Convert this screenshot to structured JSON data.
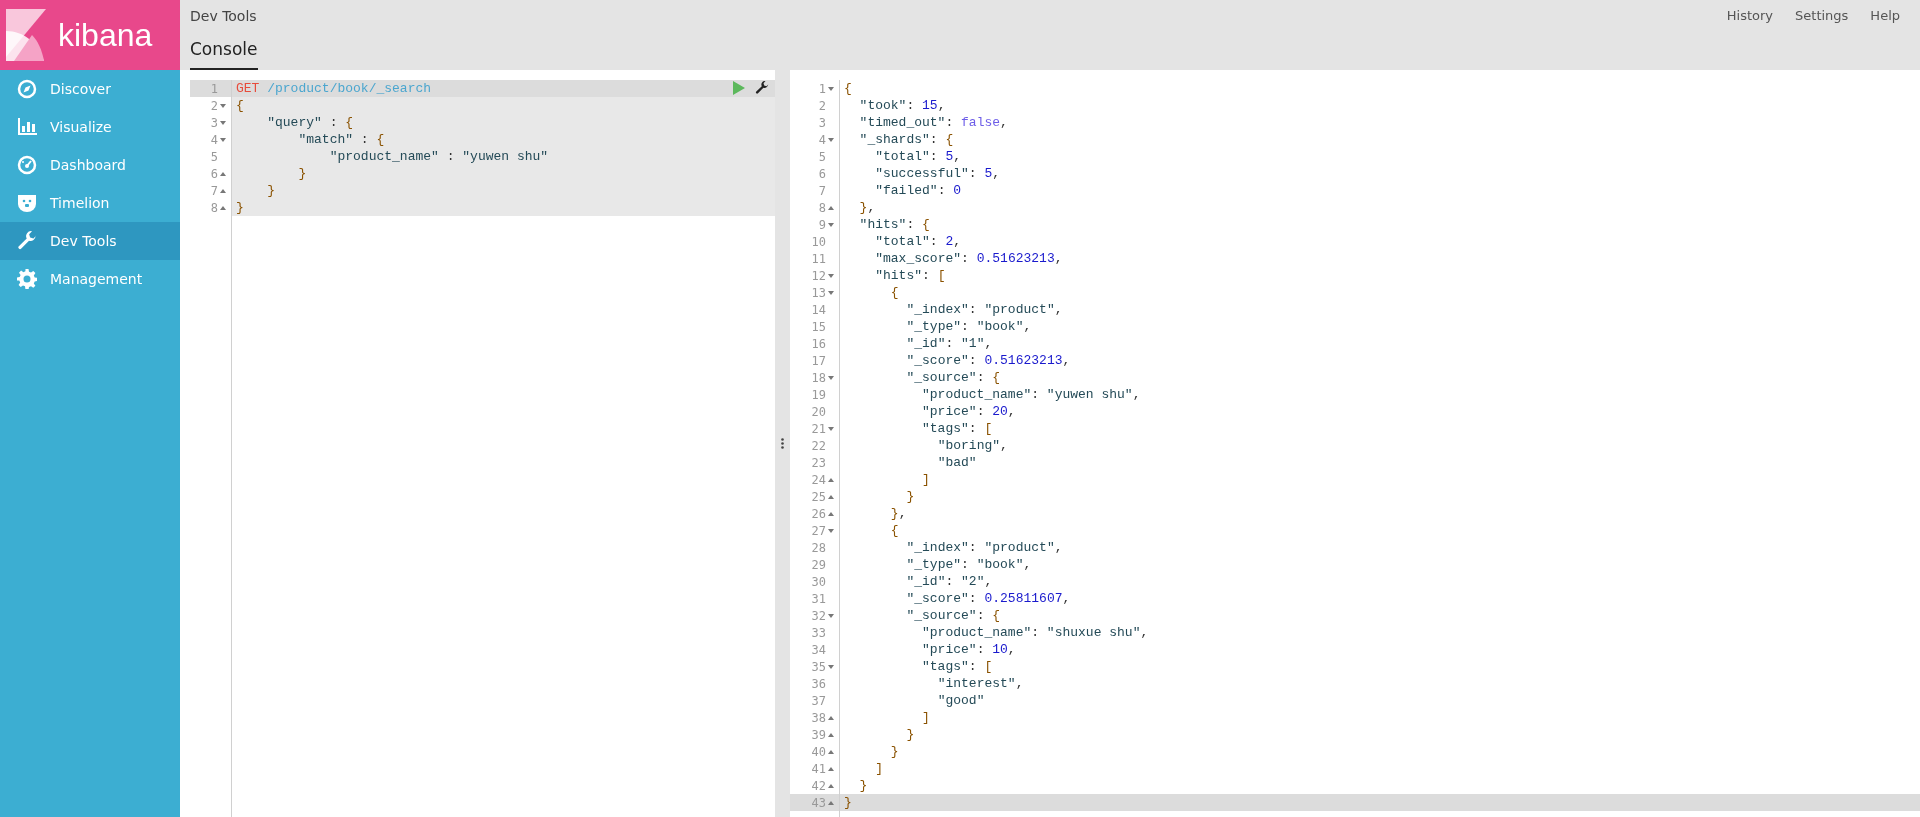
{
  "app": {
    "name": "kibana"
  },
  "nav": [
    {
      "label": "Discover",
      "selected": false
    },
    {
      "label": "Visualize",
      "selected": false
    },
    {
      "label": "Dashboard",
      "selected": false
    },
    {
      "label": "Timelion",
      "selected": false
    },
    {
      "label": "Dev Tools",
      "selected": true
    },
    {
      "label": "Management",
      "selected": false
    }
  ],
  "header": {
    "breadcrumb": "Dev Tools",
    "links": [
      "History",
      "Settings",
      "Help"
    ],
    "tabs": [
      {
        "label": "Console",
        "selected": true
      }
    ]
  },
  "request_editor": {
    "lines": [
      {
        "number": "1",
        "kind": "plain",
        "highlighted": true,
        "active": true,
        "text": "GET /product/book/_search"
      },
      {
        "number": "2",
        "kind": "open",
        "highlighted": true,
        "active": false,
        "text": "{"
      },
      {
        "number": "3",
        "kind": "open",
        "highlighted": true,
        "active": false,
        "text": "    \"query\" : {"
      },
      {
        "number": "4",
        "kind": "open",
        "highlighted": true,
        "active": false,
        "text": "        \"match\" : {"
      },
      {
        "number": "5",
        "kind": "plain",
        "highlighted": true,
        "active": false,
        "text": "            \"product_name\" : \"yuwen shu\""
      },
      {
        "number": "6",
        "kind": "close",
        "highlighted": true,
        "active": false,
        "text": "        }"
      },
      {
        "number": "7",
        "kind": "close",
        "highlighted": true,
        "active": false,
        "text": "    }"
      },
      {
        "number": "8",
        "kind": "close",
        "highlighted": true,
        "active": false,
        "text": "}"
      }
    ]
  },
  "response_editor": {
    "lines": [
      {
        "number": "1",
        "kind": "open",
        "active": false,
        "text": "{"
      },
      {
        "number": "2",
        "kind": "plain",
        "active": false,
        "text": "  \"took\": 15,"
      },
      {
        "number": "3",
        "kind": "plain",
        "active": false,
        "text": "  \"timed_out\": false,"
      },
      {
        "number": "4",
        "kind": "open",
        "active": false,
        "text": "  \"_shards\": {"
      },
      {
        "number": "5",
        "kind": "plain",
        "active": false,
        "text": "    \"total\": 5,"
      },
      {
        "number": "6",
        "kind": "plain",
        "active": false,
        "text": "    \"successful\": 5,"
      },
      {
        "number": "7",
        "kind": "plain",
        "active": false,
        "text": "    \"failed\": 0"
      },
      {
        "number": "8",
        "kind": "close",
        "active": false,
        "text": "  },"
      },
      {
        "number": "9",
        "kind": "open",
        "active": false,
        "text": "  \"hits\": {"
      },
      {
        "number": "10",
        "kind": "plain",
        "active": false,
        "text": "    \"total\": 2,"
      },
      {
        "number": "11",
        "kind": "plain",
        "active": false,
        "text": "    \"max_score\": 0.51623213,"
      },
      {
        "number": "12",
        "kind": "open",
        "active": false,
        "text": "    \"hits\": ["
      },
      {
        "number": "13",
        "kind": "open",
        "active": false,
        "text": "      {"
      },
      {
        "number": "14",
        "kind": "plain",
        "active": false,
        "text": "        \"_index\": \"product\","
      },
      {
        "number": "15",
        "kind": "plain",
        "active": false,
        "text": "        \"_type\": \"book\","
      },
      {
        "number": "16",
        "kind": "plain",
        "active": false,
        "text": "        \"_id\": \"1\","
      },
      {
        "number": "17",
        "kind": "plain",
        "active": false,
        "text": "        \"_score\": 0.51623213,"
      },
      {
        "number": "18",
        "kind": "open",
        "active": false,
        "text": "        \"_source\": {"
      },
      {
        "number": "19",
        "kind": "plain",
        "active": false,
        "text": "          \"product_name\": \"yuwen shu\","
      },
      {
        "number": "20",
        "kind": "plain",
        "active": false,
        "text": "          \"price\": 20,"
      },
      {
        "number": "21",
        "kind": "open",
        "active": false,
        "text": "          \"tags\": ["
      },
      {
        "number": "22",
        "kind": "plain",
        "active": false,
        "text": "            \"boring\","
      },
      {
        "number": "23",
        "kind": "plain",
        "active": false,
        "text": "            \"bad\""
      },
      {
        "number": "24",
        "kind": "close",
        "active": false,
        "text": "          ]"
      },
      {
        "number": "25",
        "kind": "close",
        "active": false,
        "text": "        }"
      },
      {
        "number": "26",
        "kind": "close",
        "active": false,
        "text": "      },"
      },
      {
        "number": "27",
        "kind": "open",
        "active": false,
        "text": "      {"
      },
      {
        "number": "28",
        "kind": "plain",
        "active": false,
        "text": "        \"_index\": \"product\","
      },
      {
        "number": "29",
        "kind": "plain",
        "active": false,
        "text": "        \"_type\": \"book\","
      },
      {
        "number": "30",
        "kind": "plain",
        "active": false,
        "text": "        \"_id\": \"2\","
      },
      {
        "number": "31",
        "kind": "plain",
        "active": false,
        "text": "        \"_score\": 0.25811607,"
      },
      {
        "number": "32",
        "kind": "open",
        "active": false,
        "text": "        \"_source\": {"
      },
      {
        "number": "33",
        "kind": "plain",
        "active": false,
        "text": "          \"product_name\": \"shuxue shu\","
      },
      {
        "number": "34",
        "kind": "plain",
        "active": false,
        "text": "          \"price\": 10,"
      },
      {
        "number": "35",
        "kind": "open",
        "active": false,
        "text": "          \"tags\": ["
      },
      {
        "number": "36",
        "kind": "plain",
        "active": false,
        "text": "            \"interest\","
      },
      {
        "number": "37",
        "kind": "plain",
        "active": false,
        "text": "            \"good\""
      },
      {
        "number": "38",
        "kind": "close",
        "active": false,
        "text": "          ]"
      },
      {
        "number": "39",
        "kind": "close",
        "active": false,
        "text": "        }"
      },
      {
        "number": "40",
        "kind": "close",
        "active": false,
        "text": "      }"
      },
      {
        "number": "41",
        "kind": "close",
        "active": false,
        "text": "    ]"
      },
      {
        "number": "42",
        "kind": "close",
        "active": false,
        "text": "  }"
      },
      {
        "number": "43",
        "kind": "close",
        "active": true,
        "text": "}"
      }
    ]
  }
}
